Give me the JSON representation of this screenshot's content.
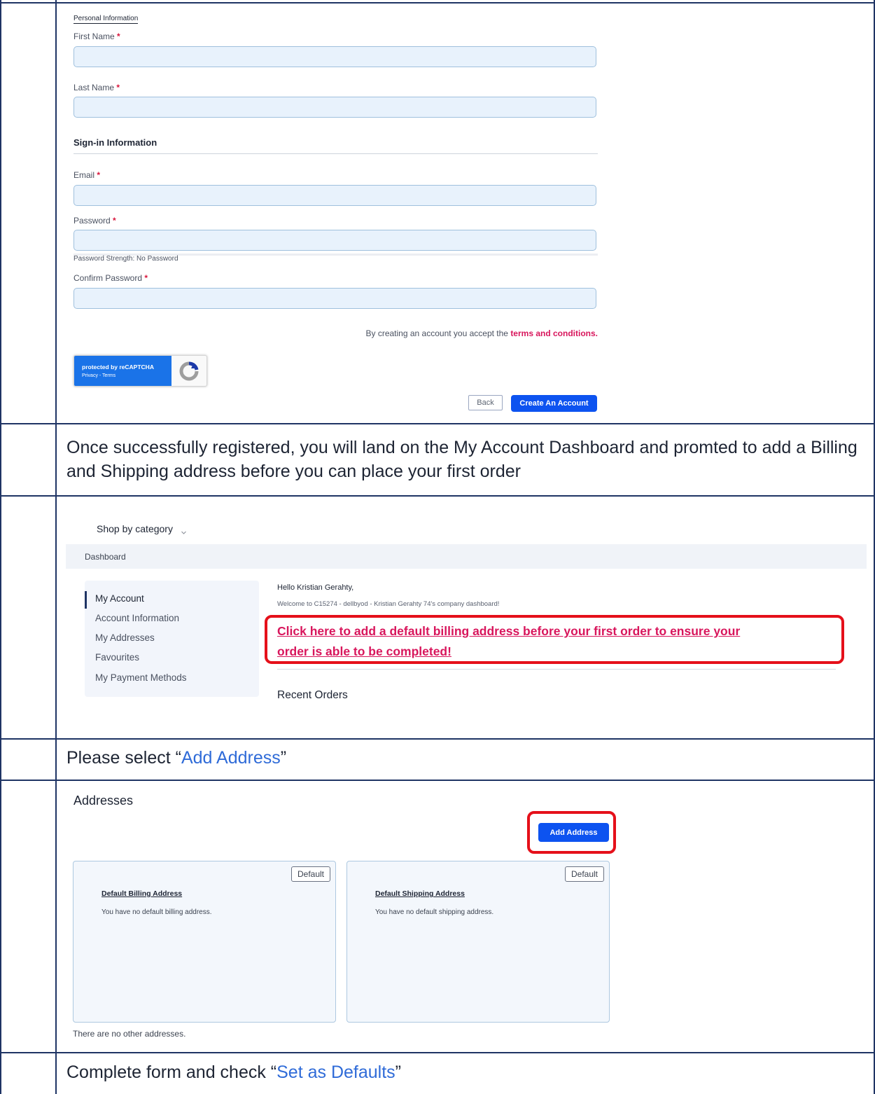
{
  "registration_form": {
    "personal_section_title": "Personal Information",
    "first_name_label": "First Name",
    "last_name_label": "Last Name",
    "signin_section_title": "Sign-in Information",
    "email_label": "Email",
    "password_label": "Password",
    "password_strength": "Password Strength: No Password",
    "confirm_password_label": "Confirm Password",
    "required_mark": "*",
    "terms_text": "By creating an account you accept the",
    "terms_link": "terms and conditions.",
    "recaptcha_line1": "protected by reCAPTCHA",
    "recaptcha_line2": "Privacy - Terms",
    "back_button": "Back",
    "create_button": "Create An Account"
  },
  "instruction_1": "Once successfully registered, you will land on the My Account Dashboard and promted to add a Billing and Shipping address before you can place your first order",
  "dashboard": {
    "shop_by_category": "Shop by category",
    "breadcrumb": "Dashboard",
    "sidebar": {
      "items": [
        {
          "label": "My Account",
          "active": true
        },
        {
          "label": "Account Information"
        },
        {
          "label": "My Addresses"
        },
        {
          "label": "Favourites"
        },
        {
          "label": "My Payment Methods"
        }
      ]
    },
    "greeting": "Hello Kristian Gerahty,",
    "welcome": "Welcome to C15274 - dellbyod - Kristian Gerahty 74's company dashboard!",
    "billing_alert_line1": "Click here to add a default billing address before your first order to ensure your",
    "billing_alert_line2": "order is able to be completed!",
    "recent_orders": "Recent Orders",
    "colors": {
      "alert": "#d8165c",
      "highlight": "#e5101a"
    }
  },
  "instruction_2": {
    "prefix": "Please select “",
    "link": "Add Address",
    "suffix": "”"
  },
  "addresses": {
    "title": "Addresses",
    "add_button": "Add Address",
    "billing": {
      "badge": "Default",
      "title": "Default Billing Address",
      "text": "You have no default billing address."
    },
    "shipping": {
      "badge": "Default",
      "title": "Default Shipping Address",
      "text": "You have no default shipping address."
    },
    "no_other": "There are no other addresses."
  },
  "instruction_3": {
    "prefix": "Complete form and check “",
    "link": "Set as Defaults",
    "suffix": "”"
  }
}
